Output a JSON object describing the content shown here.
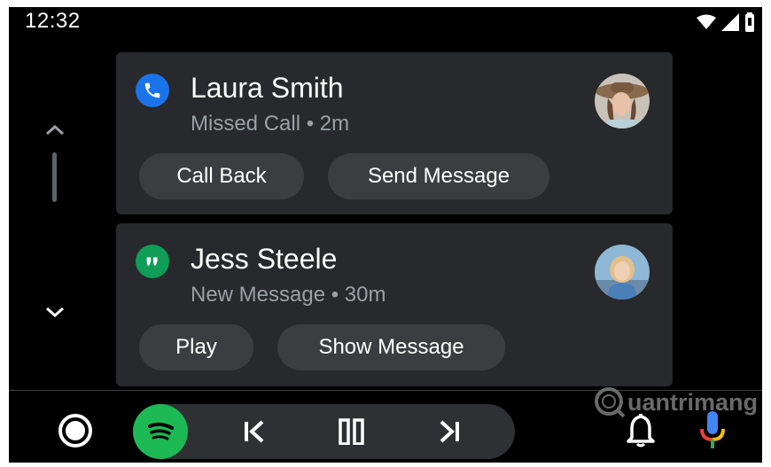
{
  "status_bar": {
    "time": "12:32",
    "icons": [
      "wifi-icon",
      "cellular-signal-icon",
      "battery-icon"
    ]
  },
  "notifications": [
    {
      "app_icon": "phone-icon",
      "title": "Laura Smith",
      "subtitle": "Missed Call • 2m",
      "actions": [
        "Call Back",
        "Send Message"
      ]
    },
    {
      "app_icon": "hangouts-icon",
      "title": "Jess Steele",
      "subtitle": "New Message • 30m",
      "actions": [
        "Play",
        "Show Message"
      ]
    }
  ],
  "bottom_bar": {
    "icons": [
      "home-icon",
      "spotify-icon",
      "skip-previous-icon",
      "pause-icon",
      "skip-next-icon",
      "notification-bell-icon",
      "microphone-icon"
    ]
  },
  "watermark": {
    "text": "uantrimang"
  },
  "colors": {
    "background": "#000000",
    "card": "#28292c",
    "chip": "#3c3d40",
    "phone_accent": "#1a73e8",
    "hangouts_accent": "#0f9d58",
    "spotify_green": "#1db954"
  }
}
